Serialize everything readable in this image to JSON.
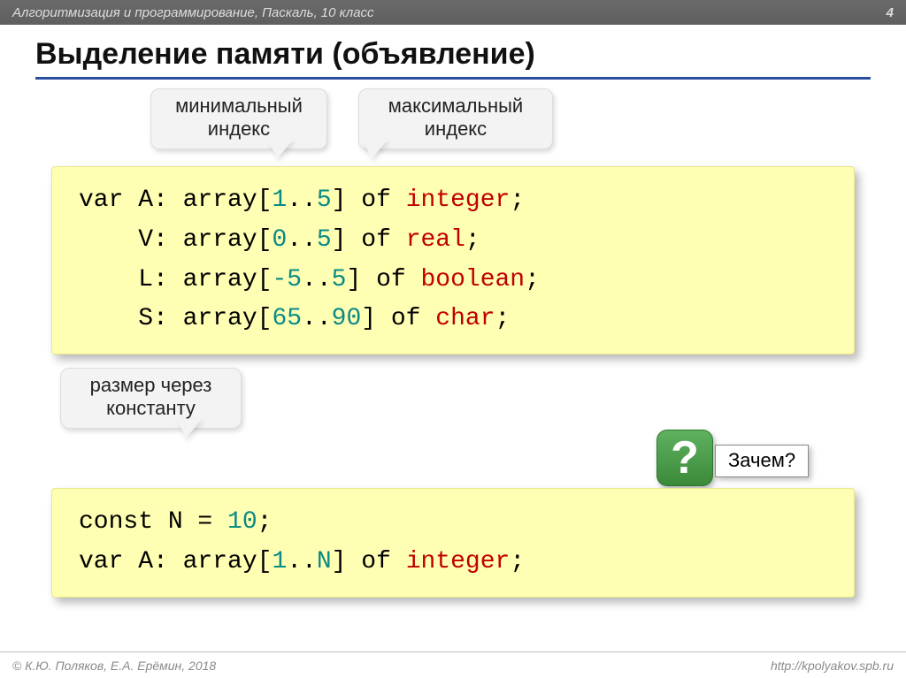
{
  "header": {
    "breadcrumb": "Алгоритмизация и программирование, Паскаль, 10 класс",
    "page": "4"
  },
  "title": "Выделение памяти (объявление)",
  "callouts": {
    "min": {
      "l1": "минимальный",
      "l2": "индекс"
    },
    "max": {
      "l1": "максимальный",
      "l2": "индекс"
    },
    "const": {
      "l1": "размер через",
      "l2": "константу"
    }
  },
  "code1": {
    "l1a": "var A: array[",
    "l1n1": "1",
    "l1m": "..",
    "l1n2": "5",
    "l1b": "] of ",
    "l1t": "integer",
    "l1e": ";",
    "l2a": "    V: array[",
    "l2n1": "0",
    "l2m": "..",
    "l2n2": "5",
    "l2b": "] of ",
    "l2t": "real",
    "l2e": ";",
    "l3a": "    L: array[",
    "l3n1": "-5",
    "l3m": "..",
    "l3n2": "5",
    "l3b": "] of ",
    "l3t": "boolean",
    "l3e": ";",
    "l4a": "    S: array[",
    "l4n1": "65",
    "l4m": "..",
    "l4n2": "90",
    "l4b": "] of ",
    "l4t": "char",
    "l4e": ";"
  },
  "code2": {
    "l1a": "const N",
    "l1eq": " = ",
    "l1n": "10",
    "l1e": ";",
    "l2a": "var A: array[",
    "l2n1": "1",
    "l2m": "..",
    "l2n2": "N",
    "l2b": "] of ",
    "l2t": "integer",
    "l2e": ";"
  },
  "question": {
    "mark": "?",
    "label": "Зачем?"
  },
  "footer": {
    "left": "© К.Ю. Поляков, Е.А. Ерёмин, 2018",
    "right": "http://kpolyakov.spb.ru"
  }
}
